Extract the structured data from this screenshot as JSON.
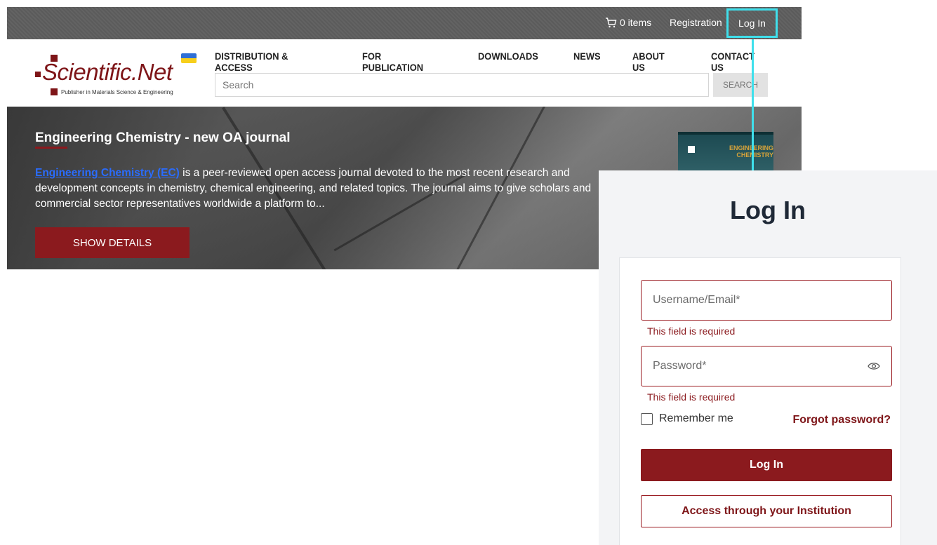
{
  "topbar": {
    "cart_label": "0 items",
    "cart_icon": "cart-icon",
    "registration_label": "Registration",
    "login_label": "Log In"
  },
  "header": {
    "logo_text": "Scientific.Net",
    "logo_tagline": "Publisher in Materials Science & Engineering",
    "nav": [
      {
        "label": "DISTRIBUTION & ACCESS"
      },
      {
        "label": "FOR PUBLICATION"
      },
      {
        "label": "DOWNLOADS"
      },
      {
        "label": "NEWS"
      },
      {
        "label": "ABOUT US"
      },
      {
        "label": "CONTACT US"
      }
    ],
    "search_placeholder": "Search",
    "search_button": "SEARCH"
  },
  "banner": {
    "title": "Engineering Chemistry - new OA journal",
    "link_text": "Engineering Chemistry (EC)",
    "body_text": " is a peer-reviewed open access journal devoted to the most recent research and development concepts in chemistry, chemical engineering, and related topics. The journal aims to give scholars and commercial sector representatives worldwide a platform to...",
    "button_label": "SHOW DETAILS",
    "cover_title": "ENGINEERING CHEMISTRY"
  },
  "login": {
    "heading": "Log In",
    "username_placeholder": "Username/Email*",
    "password_placeholder": "Password*",
    "username_error": "This field is required",
    "password_error": "This field is required",
    "remember_label": "Remember me",
    "forgot_label": "Forgot password?",
    "login_button": "Log In",
    "institution_button": "Access through your Institution"
  },
  "colors": {
    "brand": "#8b1a1e",
    "highlight": "#3fe0ec",
    "topbar": "#5e5e5e"
  }
}
